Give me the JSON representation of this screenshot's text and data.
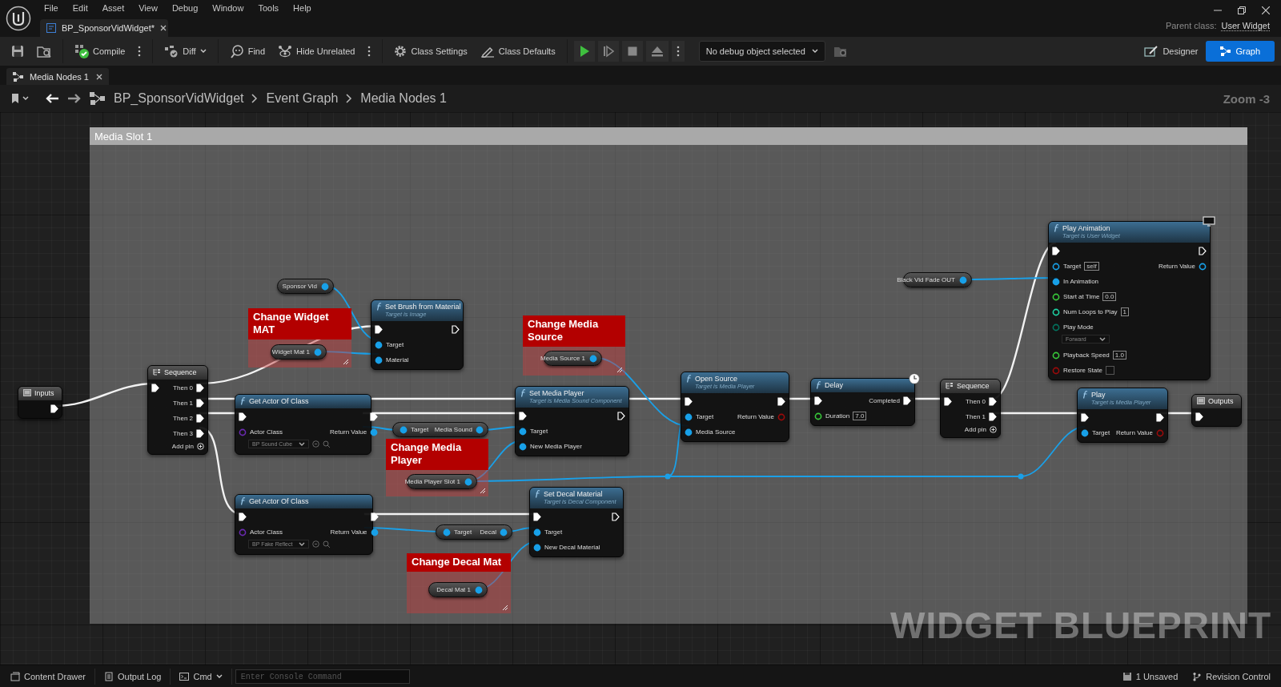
{
  "menu": [
    "File",
    "Edit",
    "Asset",
    "View",
    "Debug",
    "Window",
    "Tools",
    "Help"
  ],
  "document_tab": {
    "title": "BP_SponsorVidWidget*"
  },
  "parent_class": {
    "label": "Parent class:",
    "value": "User Widget"
  },
  "toolbar": [
    {
      "kind": "save"
    },
    {
      "kind": "browse"
    },
    {
      "kind": "compile",
      "label": "Compile"
    },
    {
      "kind": "more"
    },
    {
      "kind": "diff",
      "label": "Diff"
    },
    {
      "kind": "find",
      "label": "Find"
    },
    {
      "kind": "hide-unrelated",
      "label": "Hide Unrelated"
    },
    {
      "kind": "more"
    },
    {
      "kind": "class-settings",
      "label": "Class Settings"
    },
    {
      "kind": "class-defaults",
      "label": "Class Defaults"
    },
    {
      "kind": "play"
    },
    {
      "kind": "step"
    },
    {
      "kind": "stop"
    },
    {
      "kind": "eject"
    },
    {
      "kind": "more"
    }
  ],
  "debug_filter": {
    "value": "No debug object selected"
  },
  "modes": [
    {
      "label": "Designer",
      "selected": false
    },
    {
      "label": "Graph",
      "selected": true
    }
  ],
  "graph_tab": {
    "title": "Media Nodes 1"
  },
  "breadcrumb": [
    "BP_SponsorVidWidget",
    "Event Graph",
    "Media Nodes 1"
  ],
  "zoom": "Zoom -3",
  "comment": {
    "title": "Media Slot 1"
  },
  "nodes": [
    {
      "kind": "tunnel",
      "title": "Inputs",
      "outputs": [
        {
          "kind": "exec",
          "connected": true
        }
      ]
    },
    {
      "kind": "sequence",
      "title": "Sequence",
      "add_pin": "Add pin",
      "inputs": [
        {
          "kind": "exec",
          "connected": true
        }
      ],
      "outputs": [
        {
          "kind": "exec",
          "label": "Then 0",
          "connected": true
        },
        {
          "kind": "exec",
          "label": "Then 1",
          "connected": true
        },
        {
          "kind": "exec",
          "label": "Then 2",
          "connected": true
        },
        {
          "kind": "exec",
          "label": "Then 3",
          "connected": true
        }
      ]
    },
    {
      "kind": "variable",
      "label": "Sponsor Vid",
      "pin": {
        "kind": "object",
        "connected": true
      }
    },
    {
      "kind": "comment",
      "title": "Change Widget MAT"
    },
    {
      "kind": "variable",
      "label": "Widget Mat 1",
      "pin": {
        "kind": "object",
        "connected": true
      }
    },
    {
      "kind": "function",
      "title": "Set Brush from Material",
      "subtitle": "Target is Image",
      "latent": false,
      "widget_only": false,
      "inputs": [
        {
          "kind": "exec",
          "connected": true
        },
        {
          "kind": "object",
          "label": "Target",
          "connected": true
        },
        {
          "kind": "object",
          "label": "Material",
          "connected": true
        }
      ],
      "outputs": [
        {
          "kind": "exec",
          "connected": false
        }
      ]
    },
    {
      "kind": "function",
      "title": "Get Actor Of Class",
      "latent": false,
      "widget_only": false,
      "inputs": [
        {
          "kind": "exec",
          "connected": true
        },
        {
          "kind": "class",
          "label": "Actor Class",
          "connected": false,
          "choice": "BP Sound Cube"
        }
      ],
      "outputs": [
        {
          "kind": "exec",
          "connected": true
        },
        {
          "kind": "object",
          "label": "Return Value",
          "connected": true
        }
      ]
    },
    {
      "kind": "getter",
      "inputs": [
        {
          "kind": "object",
          "label": "Target",
          "connected": true
        }
      ],
      "outputs": [
        {
          "kind": "object",
          "label": "Media Sound",
          "connected": true
        }
      ]
    },
    {
      "kind": "comment",
      "title": "Change Media Player"
    },
    {
      "kind": "variable",
      "label": "Media Player Slot 1",
      "pin": {
        "kind": "object",
        "connected": true
      }
    },
    {
      "kind": "function",
      "title": "Get Actor Of Class",
      "latent": false,
      "widget_only": false,
      "inputs": [
        {
          "kind": "exec",
          "connected": true
        },
        {
          "kind": "class",
          "label": "Actor Class",
          "connected": false,
          "choice": "BP Fake Reflect"
        }
      ],
      "outputs": [
        {
          "kind": "exec",
          "connected": true
        },
        {
          "kind": "object",
          "label": "Return Value",
          "connected": true
        }
      ]
    },
    {
      "kind": "getter",
      "inputs": [
        {
          "kind": "object",
          "label": "Target",
          "connected": true
        }
      ],
      "outputs": [
        {
          "kind": "object",
          "label": "Decal",
          "connected": true
        }
      ]
    },
    {
      "kind": "comment",
      "title": "Change Decal Mat"
    },
    {
      "kind": "variable",
      "label": "Decal Mat 1",
      "pin": {
        "kind": "object",
        "connected": true
      }
    },
    {
      "kind": "comment",
      "title": "Change Media Source"
    },
    {
      "kind": "variable",
      "label": "Media Source 1",
      "pin": {
        "kind": "object",
        "connected": true
      }
    },
    {
      "kind": "function",
      "title": "Set Media Player",
      "subtitle": "Target is Media Sound Component",
      "latent": false,
      "widget_only": false,
      "inputs": [
        {
          "kind": "exec",
          "connected": true
        },
        {
          "kind": "object",
          "label": "Target",
          "connected": true
        },
        {
          "kind": "object",
          "label": "New Media Player",
          "connected": true
        }
      ],
      "outputs": [
        {
          "kind": "exec",
          "connected": false
        }
      ]
    },
    {
      "kind": "function",
      "title": "Set Decal Material",
      "subtitle": "Target is Decal Component",
      "latent": false,
      "widget_only": false,
      "inputs": [
        {
          "kind": "exec",
          "connected": true
        },
        {
          "kind": "object",
          "label": "Target",
          "connected": true
        },
        {
          "kind": "object",
          "label": "New Decal Material",
          "connected": true
        }
      ],
      "outputs": [
        {
          "kind": "exec",
          "connected": false
        }
      ]
    },
    {
      "kind": "function",
      "title": "Open Source",
      "subtitle": "Target is Media Player",
      "latent": false,
      "widget_only": false,
      "inputs": [
        {
          "kind": "exec",
          "connected": true
        },
        {
          "kind": "object",
          "label": "Target",
          "connected": true
        },
        {
          "kind": "object",
          "label": "Media Source",
          "connected": true
        }
      ],
      "outputs": [
        {
          "kind": "exec",
          "connected": true
        },
        {
          "kind": "bool",
          "label": "Return Value",
          "connected": false
        }
      ]
    },
    {
      "kind": "function",
      "title": "Delay",
      "latent": true,
      "widget_only": false,
      "inputs": [
        {
          "kind": "exec",
          "connected": true
        },
        {
          "kind": "float",
          "label": "Duration",
          "connected": false,
          "value": "7.0"
        }
      ],
      "outputs": [
        {
          "kind": "exec",
          "label": "Completed",
          "connected": true
        }
      ]
    },
    {
      "kind": "sequence",
      "title": "Sequence",
      "add_pin": "Add pin",
      "inputs": [
        {
          "kind": "exec",
          "connected": true
        }
      ],
      "outputs": [
        {
          "kind": "exec",
          "label": "Then 0",
          "connected": true
        },
        {
          "kind": "exec",
          "label": "Then 1",
          "connected": true
        }
      ]
    },
    {
      "kind": "variable",
      "label": "Black Vid Fade OUT",
      "pin": {
        "kind": "object",
        "connected": true
      }
    },
    {
      "kind": "function",
      "title": "Play Animation",
      "subtitle": "Target is User Widget",
      "latent": false,
      "widget_only": true,
      "inputs": [
        {
          "kind": "exec",
          "connected": true
        },
        {
          "kind": "object",
          "label": "Target",
          "connected": false,
          "value": "self"
        },
        {
          "kind": "object",
          "label": "In Animation",
          "connected": true
        },
        {
          "kind": "float",
          "label": "Start at Time",
          "connected": false,
          "value": "0.0"
        },
        {
          "kind": "int",
          "label": "Num Loops to Play",
          "connected": false,
          "value": "1"
        },
        {
          "kind": "byte",
          "label": "Play Mode",
          "connected": false,
          "choice": "Forward"
        },
        {
          "kind": "float",
          "label": "Playback Speed",
          "connected": false,
          "value": "1.0"
        },
        {
          "kind": "bool",
          "label": "Restore State",
          "connected": false,
          "checked": false
        }
      ],
      "outputs": [
        {
          "kind": "exec",
          "connected": false
        },
        {
          "kind": "object",
          "label": "Return Value",
          "connected": false
        }
      ]
    },
    {
      "kind": "function",
      "title": "Play",
      "subtitle": "Target is Media Player",
      "latent": false,
      "widget_only": false,
      "inputs": [
        {
          "kind": "exec",
          "connected": true
        },
        {
          "kind": "object",
          "label": "Target",
          "connected": true
        }
      ],
      "outputs": [
        {
          "kind": "exec",
          "connected": true
        },
        {
          "kind": "bool",
          "label": "Return Value",
          "connected": false
        }
      ]
    },
    {
      "kind": "tunnel",
      "title": "Outputs",
      "inputs": [
        {
          "kind": "exec",
          "connected": true
        }
      ]
    }
  ],
  "graph_label": "WIDGET BLUEPRINT",
  "status_bar": {
    "left": [
      {
        "kind": "content-drawer",
        "label": "Content Drawer"
      },
      {
        "kind": "output-log",
        "label": "Output Log"
      },
      {
        "kind": "cmd",
        "label": "Cmd"
      }
    ],
    "console": {
      "placeholder": "Enter Console Command"
    },
    "right": [
      {
        "kind": "unsaved",
        "label": "1 Unsaved"
      },
      {
        "kind": "revision",
        "label": "Revision Control"
      }
    ]
  }
}
